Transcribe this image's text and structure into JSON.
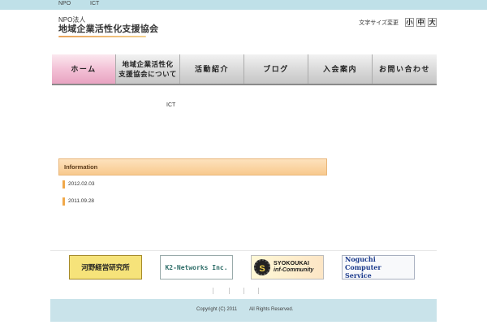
{
  "topbar": {
    "link1": "NPO",
    "link2": "ICT"
  },
  "logo": {
    "small": "NPO法人",
    "name": "地域企業活性化支援協会"
  },
  "fontsize": {
    "label": "文字サイズ変更",
    "small": "小",
    "medium": "中",
    "large": "大"
  },
  "nav": {
    "items": [
      {
        "label": "ホーム"
      },
      {
        "label": "地域企業活性化\n支援協会について"
      },
      {
        "label": "活動紹介"
      },
      {
        "label": "ブログ"
      },
      {
        "label": "入会案内"
      },
      {
        "label": "お問い合わせ"
      }
    ],
    "active_color": "#f3c1d6"
  },
  "main": {
    "text": "ICT"
  },
  "information": {
    "title": "Information",
    "dates": [
      "2012.02.03",
      "2011.09.28"
    ]
  },
  "banners": [
    {
      "text": "河野経営研究所"
    },
    {
      "text": "K2-Networks Inc."
    },
    {
      "line1": "SYOKOUKAI",
      "line2": "inf-Community",
      "icon": "S"
    },
    {
      "line1": "Noguchi Computer",
      "line2": "Service"
    }
  ],
  "footer": {
    "copyright": "Copyright (C) 2011",
    "rights": "All Rights Reserved."
  },
  "colors": {
    "topbar": "#bfe0e8",
    "footer": "#c9e3ea",
    "info": "#f8c98d"
  }
}
